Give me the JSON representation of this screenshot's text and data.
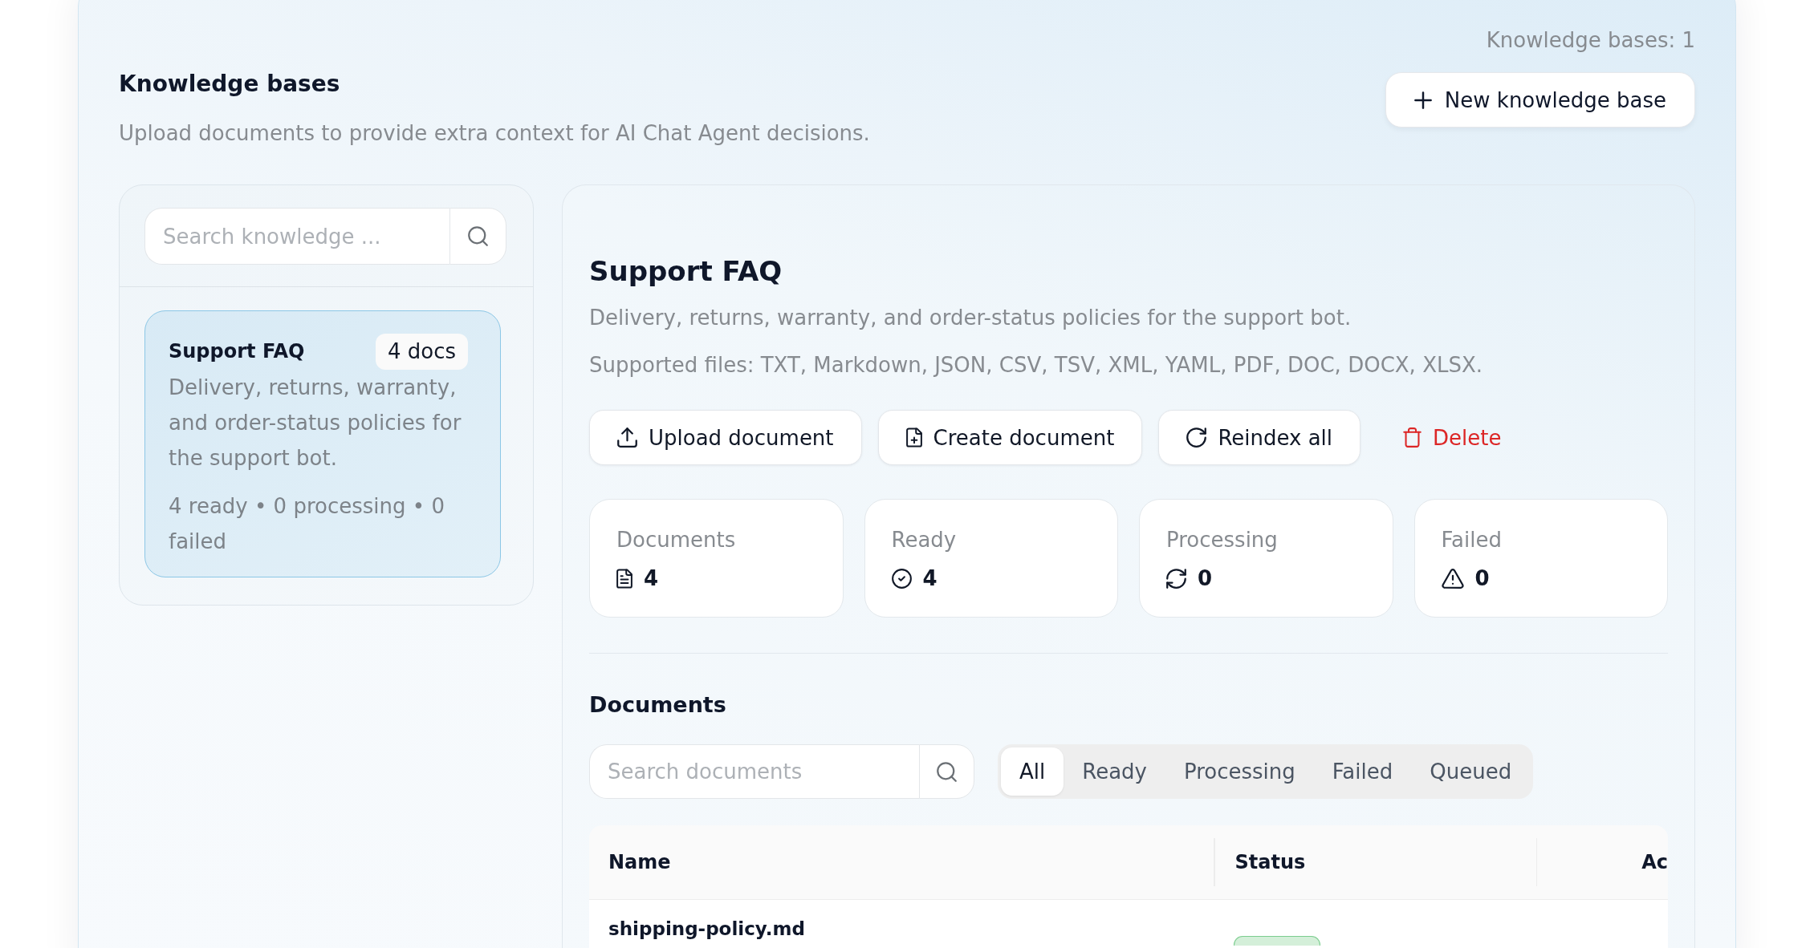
{
  "header": {
    "title": "Knowledge bases",
    "subtitle": "Upload documents to provide extra context for AI Chat Agent decisions.",
    "count": "Knowledge bases: 1",
    "new_button": "New knowledge base"
  },
  "sidebar": {
    "search": {
      "placeholder": "Search knowledge ..."
    },
    "items": [
      {
        "title": "Support FAQ",
        "badge": "4 docs",
        "description": "Delivery, returns, warranty, and order-status policies for the support bot.",
        "stats": "4 ready • 0 processing • 0 failed",
        "selected": true
      }
    ]
  },
  "detail": {
    "title": "Support FAQ",
    "description": "Delivery, returns, warranty, and order-status policies for the support bot.",
    "supported_files": "Supported files: TXT, Markdown, JSON, CSV, TSV, XML, YAML, PDF, DOC, DOCX, XLSX.",
    "actions": [
      {
        "label": "Upload document",
        "kind": "upload"
      },
      {
        "label": "Create document",
        "kind": "create"
      },
      {
        "label": "Reindex all",
        "kind": "reindex"
      },
      {
        "label": "Delete",
        "kind": "delete"
      }
    ],
    "stats": [
      {
        "label": "Documents",
        "value": "4",
        "kind": "documents"
      },
      {
        "label": "Ready",
        "value": "4",
        "kind": "ready"
      },
      {
        "label": "Processing",
        "value": "0",
        "kind": "processing"
      },
      {
        "label": "Failed",
        "value": "0",
        "kind": "failed"
      }
    ],
    "documents": {
      "title": "Documents",
      "search": {
        "placeholder": "Search documents"
      },
      "filters": [
        {
          "label": "All",
          "selected": true
        },
        {
          "label": "Ready",
          "selected": false
        },
        {
          "label": "Processing",
          "selected": false
        },
        {
          "label": "Failed",
          "selected": false
        },
        {
          "label": "Queued",
          "selected": false
        }
      ],
      "table": {
        "columns": [
          "Name",
          "Status",
          "Ac"
        ],
        "rows": [
          {
            "name": "shipping-policy.md",
            "status": {
              "color": "#d4efd9"
            }
          }
        ]
      }
    }
  }
}
